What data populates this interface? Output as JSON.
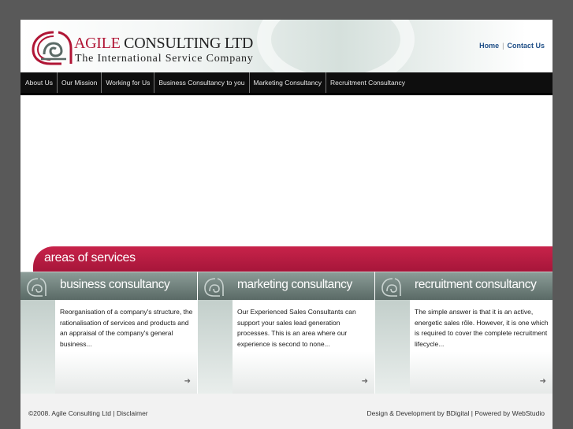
{
  "header": {
    "logo_agile": "AGILE",
    "logo_rest": " CONSULTING LTD",
    "tagline": "The International Service Company",
    "top_links": [
      "Home",
      "Contact Us"
    ]
  },
  "nav": {
    "items": [
      "About Us",
      "Our Mission",
      "Working for Us",
      "Business Consultancy to you",
      "Marketing Consultancy",
      "Recruitment Consultancy"
    ]
  },
  "areas": {
    "title": "areas of services"
  },
  "services": [
    {
      "title": "business consultancy",
      "text": "Reorganisation of a company's structure, the rationalisation of services and products and an appraisal of the company's general business...",
      "arrow": "➜"
    },
    {
      "title": "marketing consultancy",
      "text": "Our Experienced Sales Consultants can support your sales lead generation processes. This is an area where our experience is second to none...",
      "arrow": "➜"
    },
    {
      "title": "recruitment consultancy",
      "text": "The simple answer is that it is an active, energetic sales rôle. However, it is one which is required to cover the complete recruitment lifecycle...",
      "arrow": "➜"
    }
  ],
  "footer": {
    "left": "©2008. Agile Consulting Ltd | Disclaimer",
    "right": "Design & Development by BDigital | Powered by WebStudio"
  },
  "colors": {
    "brand_red": "#b01535",
    "banner_red": "#a6163a",
    "nav_bg": "#0e0e0e",
    "service_head": "#5a6a66",
    "link_blue": "#1f4f87"
  }
}
